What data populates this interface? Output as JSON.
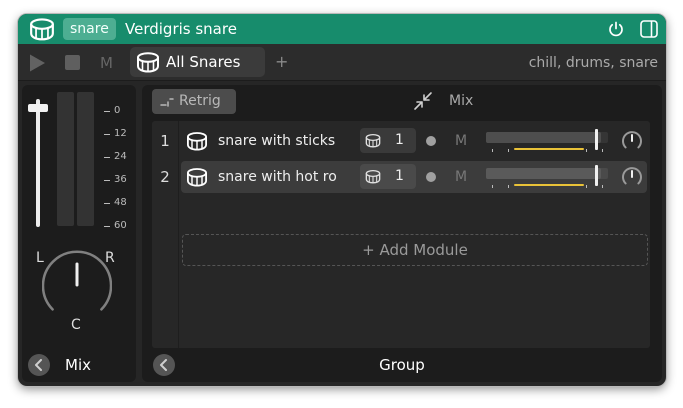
{
  "titlebar": {
    "tag": "snare",
    "title": "Verdigris snare"
  },
  "toolbar": {
    "mute_label": "M",
    "preset_tab": "All Snares",
    "add_tab": "+",
    "tags": "chill, drums, snare"
  },
  "mixer": {
    "fader_level": 0.96,
    "scale": [
      "0",
      "12",
      "24",
      "36",
      "48",
      "60"
    ],
    "pan_left": "L",
    "pan_right": "R",
    "pan_center": "C",
    "pan_value": 0,
    "footer_label": "Mix"
  },
  "group": {
    "retrig_label": "Retrig",
    "mix_label": "Mix",
    "add_module_label": "+ Add Module",
    "footer_label": "Group",
    "modules": [
      {
        "index": "1",
        "name": "snare with sticks",
        "voices": "1",
        "mute": "M",
        "volume": 0.94,
        "level": 0.57
      },
      {
        "index": "2",
        "name": "snare with hot ro",
        "voices": "1",
        "mute": "M",
        "volume": 0.94,
        "level": 0.57
      }
    ]
  },
  "colors": {
    "accent": "#178c6c",
    "tag_bg": "#4dae92",
    "level_meter": "#e9c238"
  },
  "icons": {
    "titlebar": [
      "drum-icon",
      "power-icon",
      "panel-toggle-icon"
    ],
    "toolbar": [
      "play-icon",
      "stop-icon",
      "drum-icon"
    ],
    "group": [
      "retrig-icon",
      "collapse-icon",
      "chevron-left-icon"
    ]
  }
}
